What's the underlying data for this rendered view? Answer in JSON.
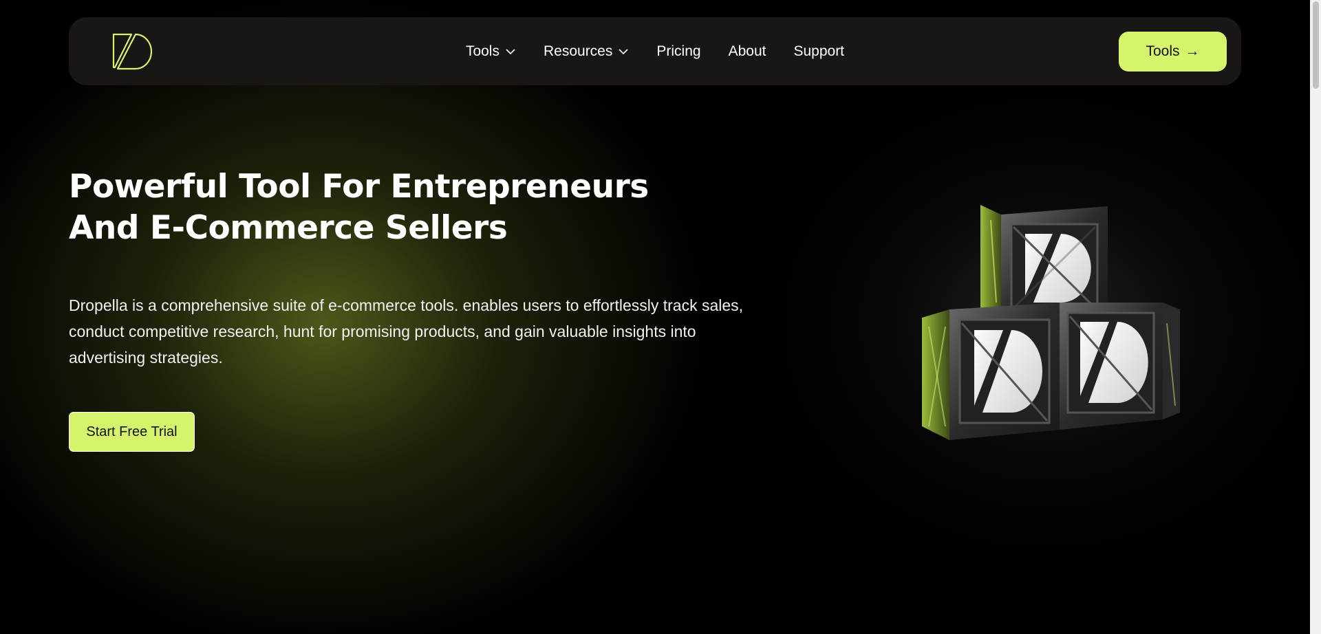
{
  "brand": {
    "logo_icon": "dropella-logo-icon",
    "accent_color": "#d6f36c"
  },
  "nav": {
    "items": [
      {
        "label": "Tools",
        "has_dropdown": true
      },
      {
        "label": "Resources",
        "has_dropdown": true
      },
      {
        "label": "Pricing",
        "has_dropdown": false
      },
      {
        "label": "About",
        "has_dropdown": false
      },
      {
        "label": "Support",
        "has_dropdown": false
      }
    ],
    "cta_label": "Tools",
    "cta_icon": "→"
  },
  "hero": {
    "title_line1": "Powerful Tool For Entrepreneurs",
    "title_line2": "And E-Commerce Sellers",
    "description": "Dropella is a comprehensive suite of e-commerce tools. enables users to effortlessly track sales, conduct competitive research, hunt for promising products, and gain valuable insights into advertising strategies.",
    "cta_label": "Start Free Trial"
  }
}
